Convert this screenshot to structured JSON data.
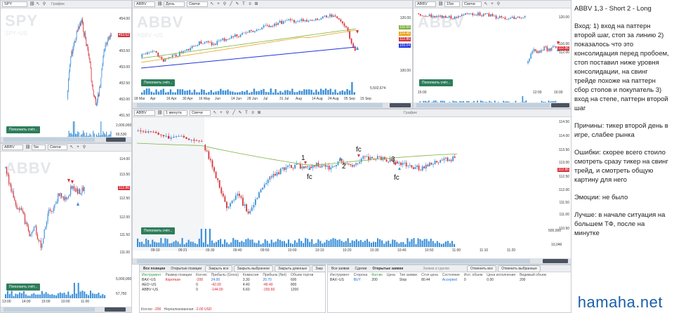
{
  "panels": {
    "spy": {
      "symbol": "SPY",
      "watermark": "SPY",
      "watermark_sub": "SPY~US",
      "chart_label": "График",
      "btn": "Пополнить счёт...",
      "prices": [
        "454.00",
        "453.62",
        "453.50",
        "453.00",
        "452.50",
        "452.00",
        "451.50"
      ],
      "times": [
        "12:00",
        "13:00",
        "14:00",
        "15:00",
        "10:00",
        "11:00"
      ],
      "vols": [
        "2,000,000",
        "65,530"
      ]
    },
    "abbv_d": {
      "symbol": "ABBV",
      "interval": "День",
      "type": "Свечи",
      "watermark": "ABBV",
      "watermark_sub": "ABBV~US",
      "btn": "Пополнить счёт...",
      "prices": [
        "120.00",
        "116.55",
        "114.46",
        "112.86",
        "109.04",
        "100.00"
      ],
      "dates": [
        "18 Mar",
        "Apr",
        "16 Apr",
        "30 Apr",
        "16 May",
        "Jun",
        "14 Jun",
        "28 Jun",
        "Jul",
        "31 Jul",
        "Aug",
        "14 Aug",
        "24 Aug",
        "05 Sep",
        "15 Sep"
      ],
      "vols": [
        "5,502,674"
      ]
    },
    "abbv_15": {
      "symbol": "ABBV",
      "interval": "15м",
      "type": "Свечи",
      "watermark": "ABBV",
      "btn": "Пополнить счёт...",
      "prices": [
        "120.00",
        "116.00",
        "112.86",
        "112.00"
      ],
      "times": [
        "15:00",
        "12:00",
        "16:00"
      ]
    },
    "abbv_5": {
      "symbol": "ABBV",
      "interval": "5м",
      "type": "Свечи",
      "watermark": "ABBV",
      "btn": "Пополнить счёт...",
      "prices": [
        "114.00",
        "113.50",
        "112.86",
        "112.50",
        "112.00",
        "111.50",
        "111.00"
      ],
      "times": [
        "13:00",
        "14:00",
        "15:00",
        "10:00",
        "11:00"
      ],
      "vols": [
        "5,000,000",
        "57,750"
      ]
    },
    "abbv_1": {
      "symbol": "ABBV",
      "interval": "1 минута",
      "type": "Свечи",
      "chart_label": "График",
      "btn": "Пополнить счёт...",
      "prices": [
        "114.50",
        "114.00",
        "113.50",
        "113.00",
        "112.86",
        "112.50",
        "112.00",
        "111.50",
        "111.00",
        "110.50"
      ],
      "times": [
        "09:10",
        "09:21",
        "09:30",
        "09:40",
        "09:50",
        "10:00",
        "10:10",
        "10:20",
        "10:30",
        "10:40",
        "10:50",
        "11:00",
        "11:10",
        "11:20"
      ],
      "vols": [
        "500,000",
        "10,046"
      ],
      "annotations": [
        "1",
        "2",
        "3",
        "fc",
        "fc",
        "fc"
      ]
    }
  },
  "positions": {
    "tabs": [
      "Все позиции",
      "Открытые позиции"
    ],
    "buttons": [
      "Закрыть все",
      "Закрыть выбранное",
      "Закрыть длинные",
      "Закр"
    ],
    "headers": [
      "Инструмент",
      "Размер позиции",
      "Кол-во",
      "Прибыль (Gross)",
      "Комиссия",
      "Прибыль (Net)",
      "Объем торгов"
    ],
    "rows": [
      [
        "BAX~US",
        "Короткая",
        "-200",
        "24.00",
        "3.30",
        "20.70",
        "600"
      ],
      [
        "AEO~US",
        "",
        "0",
        "-42.00",
        "4.40",
        "-46.40",
        "800"
      ],
      [
        "ABBV~US",
        "",
        "0",
        "-144.00",
        "6.60",
        "-150.60",
        "1200"
      ]
    ],
    "footer_label": "Кол-во:",
    "footer_val": "-200",
    "footer_label2": "Нереализованная:",
    "footer_val2": "-2.00 USD"
  },
  "orders": {
    "tabs": [
      "Все заявки",
      "Сделки",
      "Открытые заявки"
    ],
    "panel_title": "Заявки и сделки",
    "buttons": [
      "Отменить все",
      "Отменить выбранные"
    ],
    "headers": [
      "Инструмент",
      "Сторона",
      "Кол-во",
      "Цена",
      "Тип заявки",
      "Стоп цена",
      "Состояние",
      "Исп. объем",
      "Цена исполнения",
      "Видимый объем"
    ],
    "row": [
      "BAX~US",
      "BUY",
      "200",
      "",
      "Stop",
      "80.44",
      "Accepted",
      "0",
      "0.00",
      "200"
    ]
  },
  "notes": [
    "ABBV 1,3 - Short 2 - Long",
    "Вход: 1) вход на паттерн второй шаг, стоп за линию 2) показалось что это консолидация перед пробоем, стоп поставил ниже уровня консолидации, на свинг трейде похоже на паттерн сбор стопов и покупатель  3) вход на степе, паттерн второй шаг",
    "Причины: тикер второй день в игре, слабее рынка",
    "Ошибки: скорее всего стоило смотреть сразу тикер на свинг трейд, и смотреть общую картину для него",
    "Эмоции: не было",
    "Лучше: в начале ситуация на большем ТФ, после на минутке"
  ],
  "brand": "hamaha.net",
  "colors": {
    "up": "#3a8fd8",
    "down": "#d6333b",
    "ma_green": "#7cb342",
    "ma_orange": "#e8a317",
    "ma_blue": "#2233dd",
    "price_red": "#d6333b"
  }
}
